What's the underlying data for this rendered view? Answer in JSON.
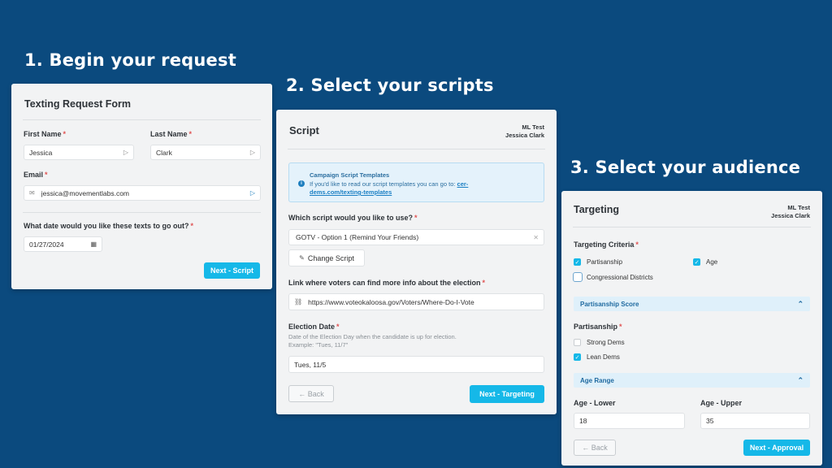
{
  "steps": {
    "one": "1. Begin your request",
    "two": "2. Select your scripts",
    "three": "3. Select your audience"
  },
  "form1": {
    "title": "Texting Request Form",
    "first_name_label": "First Name",
    "first_name_value": "Jessica",
    "last_name_label": "Last Name",
    "last_name_value": "Clark",
    "email_label": "Email",
    "email_value": "jessica@movementlabs.com",
    "date_question": "What date would you like these texts to go out?",
    "date_value": "01/27/2024",
    "next_label": "Next - Script"
  },
  "form2": {
    "title": "Script",
    "org": "ML Test",
    "user": "Jessica Clark",
    "info_title": "Campaign Script Templates",
    "info_text": "If you'd like to read our script templates you can go to:",
    "info_link_1": "cer-",
    "info_link_2": "dems.com/texting-templates",
    "script_question": "Which script would you like to use?",
    "script_value": "GOTV - Option 1 (Remind Your Friends)",
    "change_script_label": "Change Script",
    "link_label": "Link where voters can find more info about the election",
    "link_value": "https://www.voteokaloosa.gov/Voters/Where-Do-I-Vote",
    "election_date_label": "Election Date",
    "election_hint_1": "Date of the Election Day when the candidate is up for election.",
    "election_hint_2": "Example: \"Tues, 11/7\"",
    "election_date_value": "Tues, 11/5",
    "back_label": "← Back",
    "next_label": "Next - Targeting"
  },
  "form3": {
    "title": "Targeting",
    "org": "ML Test",
    "user": "Jessica Clark",
    "criteria_label": "Targeting Criteria",
    "crit_partisanship": "Partisanship",
    "crit_age": "Age",
    "crit_districts": "Congressional Districts",
    "partisanship_score_header": "Partisanship Score",
    "partisanship_label": "Partisanship",
    "strong_dems": "Strong Dems",
    "lean_dems": "Lean Dems",
    "age_range_header": "Age Range",
    "age_lower_label": "Age - Lower",
    "age_upper_label": "Age - Upper",
    "age_lower_value": "18",
    "age_upper_value": "35",
    "back_label": "← Back",
    "next_label": "Next - Approval"
  },
  "icons": {
    "asterisk": "*",
    "check": "✓",
    "chevron_up": "⌃",
    "close": "✕",
    "info": "i",
    "field_marker": "▷",
    "email": "✉",
    "calendar": "▦",
    "edit": "✎",
    "link": "⛓"
  },
  "colors": {
    "background": "#0b4a7e",
    "accent": "#15b8e8",
    "panel": "#f2f3f4",
    "required": "#e05252"
  }
}
